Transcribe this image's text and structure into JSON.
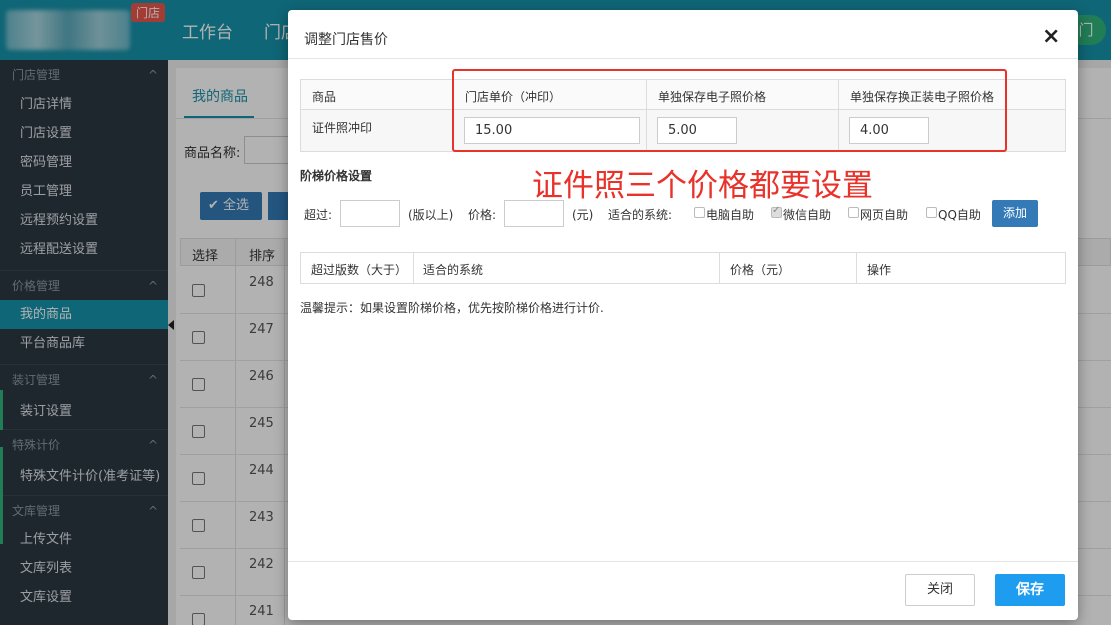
{
  "topbar": {
    "store_badge": "门店",
    "nav": [
      "工作台",
      "门店"
    ],
    "right_button": "门"
  },
  "sidebar": {
    "groups": [
      {
        "title": "门店管理",
        "items": [
          "门店详情",
          "门店设置",
          "密码管理",
          "员工管理",
          "远程预约设置",
          "远程配送设置"
        ]
      },
      {
        "title": "价格管理",
        "items": [
          "我的商品",
          "平台商品库"
        ]
      },
      {
        "title": "装订管理",
        "items": [
          "装订设置"
        ]
      },
      {
        "title": "特殊计价",
        "items": [
          "特殊文件计价(准考证等)"
        ]
      },
      {
        "title": "文库管理",
        "items": [
          "上传文件",
          "文库列表",
          "文库设置"
        ]
      }
    ],
    "active_item": "我的商品",
    "chevron": "^"
  },
  "background": {
    "tab": "我的商品",
    "name_label": "商品名称:",
    "select_all": "全选",
    "headers": [
      "选择",
      "排序"
    ],
    "sort_values": [
      "248",
      "247",
      "246",
      "245",
      "244",
      "243",
      "242",
      "241"
    ]
  },
  "modal": {
    "title": "调整门店售价",
    "close_icon": "×",
    "price_table": {
      "headers": [
        "商品",
        "门店单价（冲印）",
        "单独保存电子照价格",
        "单独保存换正装电子照价格"
      ],
      "product": "证件照冲印",
      "values": [
        "15.00",
        "5.00",
        "4.00"
      ]
    },
    "annotation": "证件照三个价格都要设置",
    "tier": {
      "title": "阶梯价格设置",
      "over_label": "超过:",
      "unit_label": "(版以上)",
      "price_label": "价格:",
      "yuan_label": "(元)",
      "systems_label": "适合的系统:",
      "checkboxes": [
        {
          "label": "电脑自助",
          "checked": false
        },
        {
          "label": "微信自助",
          "checked": true
        },
        {
          "label": "网页自助",
          "checked": false
        },
        {
          "label": "QQ自助",
          "checked": false
        }
      ],
      "add_button": "添加",
      "table_headers": [
        "超过版数（大于）",
        "适合的系统",
        "价格（元）",
        "操作"
      ]
    },
    "tip": "温馨提示：如果设置阶梯价格，优先按阶梯价格进行计价.",
    "buttons": {
      "close": "关闭",
      "save": "保存"
    }
  },
  "colors": {
    "topbar": "#1692a9",
    "sidebar": "#2d3842",
    "primary_button": "#337ab7",
    "save_button": "#1e9cf0",
    "annotation_red": "#e8322a"
  }
}
